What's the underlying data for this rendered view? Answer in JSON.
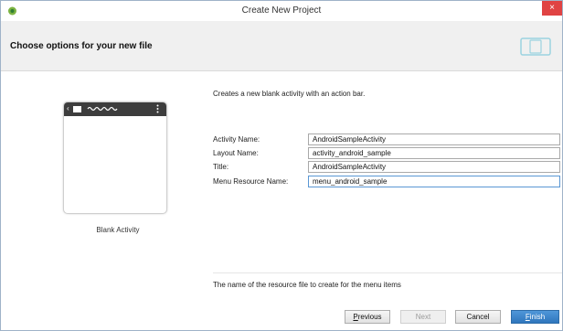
{
  "window": {
    "title": "Create New Project",
    "close_glyph": "×",
    "app_icon": "android-studio-icon"
  },
  "header": {
    "title": "Choose options for your new file",
    "icon": "device-frame-icon"
  },
  "preview": {
    "back_glyph": "‹",
    "label": "Blank Activity"
  },
  "form": {
    "description": "Creates a new blank activity with an action bar.",
    "fields": [
      {
        "label": "Activity Name:",
        "value": "AndroidSampleActivity"
      },
      {
        "label": "Layout Name:",
        "value": "activity_android_sample"
      },
      {
        "label": "Title:",
        "value": "AndroidSampleActivity"
      },
      {
        "label": "Menu Resource Name:",
        "value": "menu_android_sample"
      }
    ],
    "hint": "The name of the resource file to create for the menu items"
  },
  "buttons": {
    "previous": {
      "first": "P",
      "rest": "revious"
    },
    "next": "Next",
    "cancel": "Cancel",
    "finish": {
      "first": "F",
      "rest": "inish"
    }
  },
  "colors": {
    "accent": "#2f76bd",
    "close": "#e04343",
    "focus_border": "#5a97d4",
    "header_bg": "#f0f0f0"
  }
}
